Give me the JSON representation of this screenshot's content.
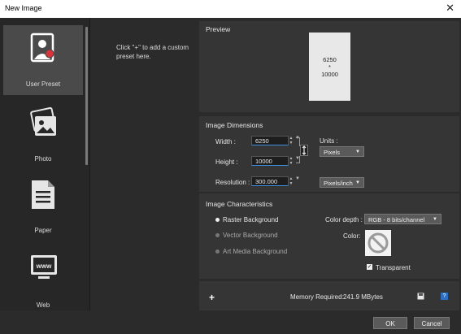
{
  "window": {
    "title": "New Image",
    "close_glyph": "✕"
  },
  "presets": [
    {
      "label": "User Preset",
      "icon": "user-preset-icon",
      "selected": true
    },
    {
      "label": "Photo",
      "icon": "photo-icon",
      "selected": false
    },
    {
      "label": "Paper",
      "icon": "paper-icon",
      "selected": false
    },
    {
      "label": "Web",
      "icon": "web-icon",
      "selected": false
    }
  ],
  "custom_hint": "Click \"+\" to add a custom preset here.",
  "preview": {
    "title": "Preview",
    "width_text": "6250",
    "by_text": "*",
    "height_text": "10000"
  },
  "dimensions": {
    "title": "Image Dimensions",
    "width_label": "Width :",
    "width_value": "6250",
    "height_label": "Height :",
    "height_value": "10000",
    "resolution_label": "Resolution :",
    "resolution_value": "300.000",
    "units_label": "Units :",
    "units_value": "Pixels",
    "resolution_units_value": "Pixels/inch"
  },
  "characteristics": {
    "title": "Image Characteristics",
    "options": [
      {
        "label": "Raster Background",
        "checked": true
      },
      {
        "label": "Vector Background",
        "checked": false
      },
      {
        "label": "Art Media Background",
        "checked": false
      }
    ],
    "color_depth_label": "Color depth :",
    "color_depth_value": "RGB - 8 bits/channel",
    "color_label": "Color:",
    "transparent_label": "Transparent",
    "transparent_checked": true
  },
  "footer": {
    "add_glyph": "+",
    "memory_label": "Memory Required:",
    "memory_value": "241.9 MBytes",
    "help_glyph": "?",
    "ok_label": "OK",
    "cancel_label": "Cancel"
  },
  "colors": {
    "accent": "#3d8fe0",
    "panel": "#353535",
    "background": "#2b2b2b",
    "badge": "#d9343a"
  }
}
